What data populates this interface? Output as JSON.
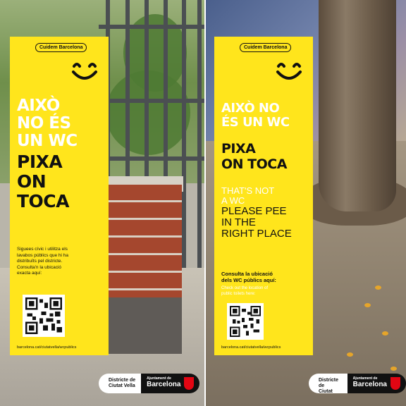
{
  "left": {
    "brand": "Cuidem Barcelona",
    "headline_white": [
      "AIXÒ",
      "NO ÉS",
      "UN WC"
    ],
    "headline_black": [
      "PIXA",
      "ON",
      "TOCA"
    ],
    "body_ca": [
      "Siguees cívic i utilitza els",
      "lavabos públics que hi ha",
      "distribuïts pel districte.",
      "Consulta'n la ubicació",
      "exacta aquí:"
    ],
    "url": "barcelona.cat/ciutatvella/wcpublics"
  },
  "right": {
    "brand": "Cuidem Barcelona",
    "headline_white": [
      "AIXÒ NO",
      "ÉS UN WC"
    ],
    "headline_black": [
      "PIXA",
      "ON TOCA"
    ],
    "en_white": [
      "THAT'S NOT",
      "A WC"
    ],
    "en_black": [
      "PLEASE PEE",
      "IN THE",
      "RIGHT PLACE"
    ],
    "consult_ca": [
      "Consulta la ubicació",
      "dels WC públics aquí:"
    ],
    "consult_en": [
      "Check out the location of",
      "public toilets here:"
    ],
    "url": "barcelona.cat/ciutatvella/wcpublics"
  },
  "logo": {
    "district": [
      "Districte de",
      "Ciutat Vella"
    ],
    "ajuntament_small": "Ajuntament de",
    "ajuntament_big": "Barcelona"
  },
  "colors": {
    "poster_yellow": "#ffe51c",
    "text_black": "#111111",
    "brand_red": "#e30613"
  },
  "icons": [
    "smiley-icon",
    "qr-code",
    "barcelona-shield-icon"
  ]
}
